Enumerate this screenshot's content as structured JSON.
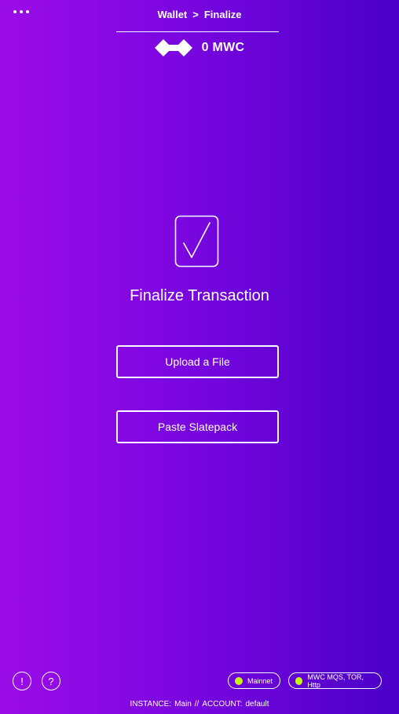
{
  "header": {
    "menu_icon": "more-horizontal-icon",
    "breadcrumb": {
      "parent": "Wallet",
      "separator": ">",
      "current": "Finalize"
    },
    "balance": {
      "logo_icon": "mwc-logo-icon",
      "amount": "0 MWC"
    }
  },
  "main": {
    "icon": "checkbox-check-icon",
    "title": "Finalize Transaction",
    "buttons": {
      "upload_label": "Upload a File",
      "paste_label": "Paste Slatepack"
    }
  },
  "footer": {
    "alert_icon": "exclamation-circle-icon",
    "alert_glyph": "!",
    "help_icon": "question-circle-icon",
    "help_glyph": "?",
    "network_status": {
      "label": "Mainnet",
      "dot_color": "#c6f31a"
    },
    "listener_status": {
      "label": "MWC MQS, TOR, Http",
      "dot_color": "#c6f31a"
    },
    "instance_label": "INSTANCE:",
    "instance_value": "Main",
    "divider": "//",
    "account_label": "ACCOUNT:",
    "account_value": "default"
  },
  "colors": {
    "gradient_left": "#9b0ce8",
    "gradient_right": "#4a00c8",
    "foreground": "#ffffff",
    "status_green": "#c6f31a"
  }
}
